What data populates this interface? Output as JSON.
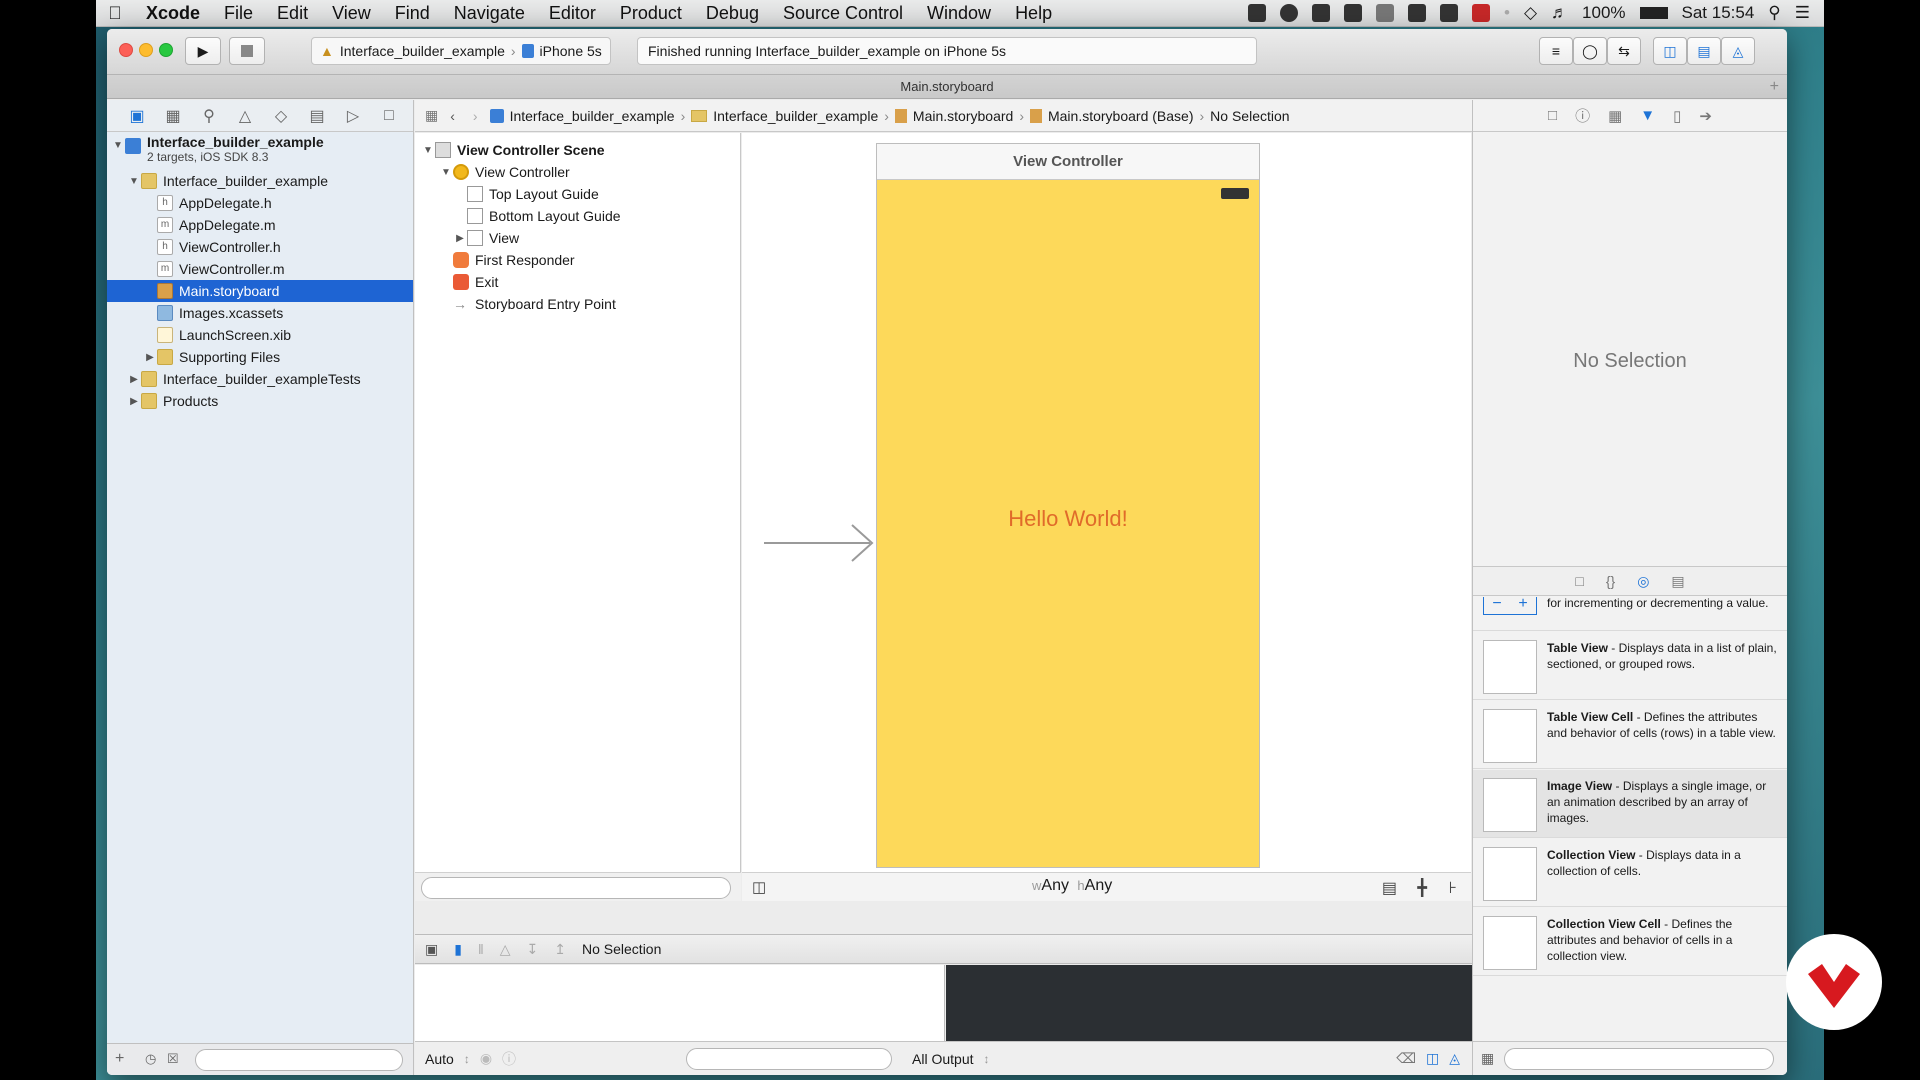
{
  "menubar": {
    "app": "Xcode",
    "items": [
      "File",
      "Edit",
      "View",
      "Find",
      "Navigate",
      "Editor",
      "Product",
      "Debug",
      "Source Control",
      "Window",
      "Help"
    ],
    "battery": "100%",
    "clock": "Sat 15:54"
  },
  "toolbar": {
    "scheme": "Interface_builder_example",
    "device": "iPhone 5s",
    "status": "Finished running Interface_builder_example on iPhone 5s"
  },
  "tab_title": "Main.storyboard",
  "navigator": {
    "project": "Interface_builder_example",
    "project_sub": "2 targets, iOS SDK 8.3",
    "items": [
      {
        "label": "Interface_builder_example",
        "indent": 1,
        "kind": "folder",
        "open": true
      },
      {
        "label": "AppDelegate.h",
        "indent": 2,
        "kind": "h"
      },
      {
        "label": "AppDelegate.m",
        "indent": 2,
        "kind": "m"
      },
      {
        "label": "ViewController.h",
        "indent": 2,
        "kind": "h"
      },
      {
        "label": "ViewController.m",
        "indent": 2,
        "kind": "m"
      },
      {
        "label": "Main.storyboard",
        "indent": 2,
        "kind": "storyboard",
        "selected": true
      },
      {
        "label": "Images.xcassets",
        "indent": 2,
        "kind": "xcassets"
      },
      {
        "label": "LaunchScreen.xib",
        "indent": 2,
        "kind": "xib"
      },
      {
        "label": "Supporting Files",
        "indent": 2,
        "kind": "folder",
        "open": false
      },
      {
        "label": "Interface_builder_exampleTests",
        "indent": 1,
        "kind": "folder",
        "open": false
      },
      {
        "label": "Products",
        "indent": 1,
        "kind": "folder",
        "open": false
      }
    ]
  },
  "jumpbar": {
    "crumbs": [
      "Interface_builder_example",
      "Interface_builder_example",
      "Main.storyboard",
      "Main.storyboard (Base)",
      "No Selection"
    ]
  },
  "outline": {
    "scene": "View Controller Scene",
    "controller": "View Controller",
    "top_guide": "Top Layout Guide",
    "bottom_guide": "Bottom Layout Guide",
    "view": "View",
    "first_responder": "First Responder",
    "exit": "Exit",
    "entry_point": "Storyboard Entry Point"
  },
  "canvas": {
    "vc_title": "View Controller",
    "label_text": "Hello World!",
    "size_w": "Any",
    "size_h": "Any",
    "size_w_prefix": "w",
    "size_h_prefix": "h",
    "background_color": "#fdd95a",
    "label_color": "#e06b2a"
  },
  "debug": {
    "selection": "No Selection",
    "auto": "Auto",
    "output": "All Output"
  },
  "inspector": {
    "no_selection": "No Selection"
  },
  "library": {
    "partial_top": "for incrementing or decrementing a value.",
    "items": [
      {
        "title": "Table View",
        "desc": " - Displays data in a list of plain, sectioned, or grouped rows."
      },
      {
        "title": "Table View Cell",
        "desc": " - Defines the attributes and behavior of cells (rows) in a table view."
      },
      {
        "title": "Image View",
        "desc": " - Displays a single image, or an animation described by an array of images."
      },
      {
        "title": "Collection View",
        "desc": " - Displays data in a collection of cells."
      },
      {
        "title": "Collection View Cell",
        "desc": " - Defines the attributes and behavior of cells in a collection view."
      }
    ]
  }
}
